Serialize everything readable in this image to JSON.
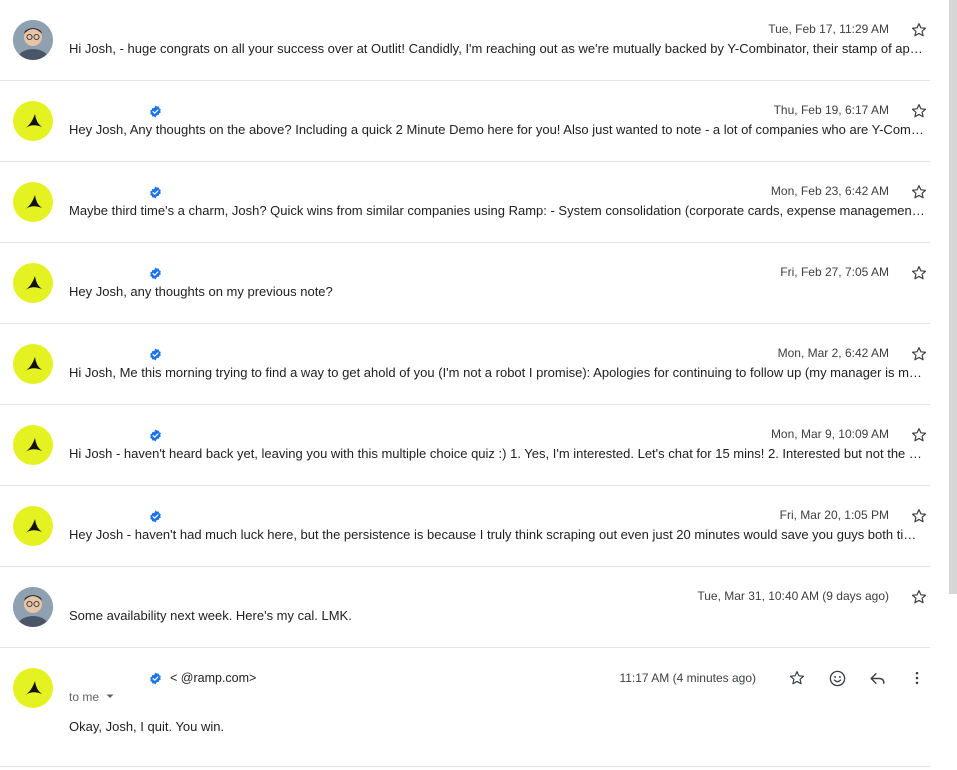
{
  "messages": [
    {
      "sender_kind": "person",
      "date": "Tue, Feb 17, 11:29 AM",
      "snippet": "Hi Josh, - huge congrats on all your success over at Outlit! Candidly, I'm reaching out as we're mutually backed by Y-Combinator, their stamp of ap…",
      "verified": false
    },
    {
      "sender_kind": "ramp",
      "date": "Thu, Feb 19, 6:17 AM",
      "snippet": "Hey Josh, Any thoughts on the above? Including a quick 2 Minute Demo here for you! Also just wanted to note - a lot of companies who are Y-Com…",
      "verified": true
    },
    {
      "sender_kind": "ramp",
      "date": "Mon, Feb 23, 6:42 AM",
      "snippet": "Maybe third time's a charm, Josh? Quick wins from similar companies using Ramp: - System consolidation (corporate cards, expense management…",
      "verified": true
    },
    {
      "sender_kind": "ramp",
      "date": "Fri, Feb 27, 7:05 AM",
      "snippet": "Hey Josh, any thoughts on my previous note?",
      "verified": true
    },
    {
      "sender_kind": "ramp",
      "date": "Mon, Mar 2, 6:42 AM",
      "snippet": "Hi Josh, Me this morning trying to find a way to get ahold of you (I'm not a robot I promise): Apologies for continuing to follow up (my manager is m…",
      "verified": true
    },
    {
      "sender_kind": "ramp",
      "date": "Mon, Mar 9, 10:09 AM",
      "snippet": "Hi Josh - haven't heard back yet, leaving you with this multiple choice quiz :) 1. Yes, I'm interested. Let's chat for 15 mins! 2. Interested but not the r…",
      "verified": true
    },
    {
      "sender_kind": "ramp",
      "date": "Fri, Mar 20, 1:05 PM",
      "snippet": "Hey Josh - haven't had much luck here, but the persistence is because I truly think scraping out even just 20 minutes would save you guys both tim…",
      "verified": true
    },
    {
      "sender_kind": "person",
      "date": "Tue, Mar 31, 10:40 AM (9 days ago)",
      "snippet": "Some availability next week. Here's my cal. LMK.",
      "verified": false
    }
  ],
  "expanded": {
    "email_suffix": "<       @ramp.com>",
    "date": "11:17 AM (4 minutes ago)",
    "to_label": "to me",
    "body": "Okay, Josh, I quit. You win."
  },
  "colors": {
    "ramp_accent": "#e4f222",
    "verified": "#1a73e8"
  },
  "icons": {
    "star": "star-icon",
    "emoji": "emoji-icon",
    "reply": "reply-icon",
    "more": "more-vert-icon",
    "dropdown": "chevron-down-icon"
  }
}
